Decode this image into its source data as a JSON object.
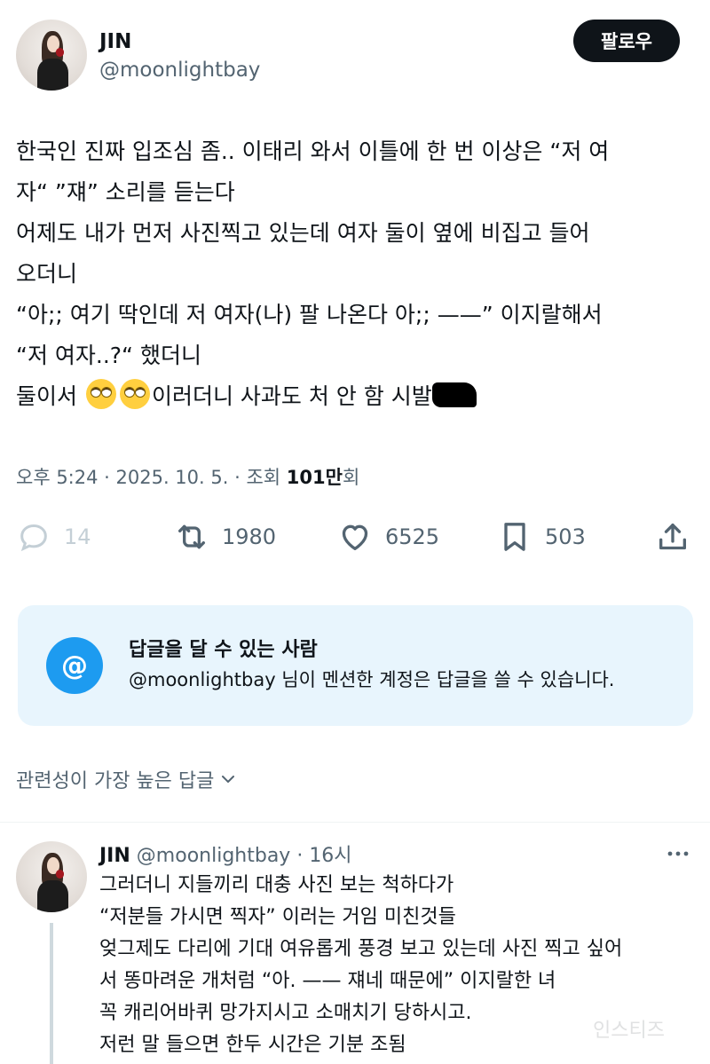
{
  "header": {
    "display_name": "JIN",
    "handle": "@moonlightbay",
    "follow_label": "팔로우"
  },
  "tweet": {
    "lines": [
      "한국인 진짜 입조심 좀.. 이태리 와서 이틀에 한 번 이상은 “저 여",
      "자“ ”쟤” 소리를 듣는다",
      "어제도 내가 먼저 사진찍고 있는데 여자 둘이 옆에 비집고 들어",
      "오더니",
      "“아;; 여기 딱인데 저 여자(나) 팔 나온다 아;; ——” 이지랄해서",
      "“저 여자..?“ 했더니"
    ],
    "last_line_prefix": "둘이서 ",
    "last_line_suffix": "이러더니 사과도 처 안 함 시발",
    "emoji": [
      "face-with-rolling-eyes",
      "face-with-rolling-eyes"
    ]
  },
  "meta": {
    "time": "오후 5:24",
    "sep1": " · ",
    "date": "2025. 10. 5.",
    "sep2": " · ",
    "views_label": "조회 ",
    "views_value": "101만",
    "views_suffix": "회"
  },
  "actions": {
    "reply_count": "14",
    "retweet_count": "1980",
    "like_count": "6525",
    "bookmark_count": "503",
    "icons": [
      "reply-icon",
      "retweet-icon",
      "like-icon",
      "bookmark-icon",
      "share-icon"
    ]
  },
  "reply_restriction": {
    "icon": "@",
    "title": "답글을 달 수 있는 사람",
    "description": "@moonlightbay 님이 멘션한 계정은 답글을 쓸 수 있습니다.",
    "bg_color": "#e8f5fd",
    "icon_color": "#1d9bf0"
  },
  "sort": {
    "label": "관련성이 가장 높은 답글"
  },
  "reply": {
    "name": "JIN",
    "handle": "@moonlightbay",
    "dot": " · ",
    "time": "16시",
    "lines": [
      "그러더니 지들끼리 대충 사진 보는 척하다가",
      "“저분들 가시면 찍자” 이러는 거임 미친것들",
      "엊그제도 다리에 기대 여유롭게 풍경 보고 있는데 사진 찍고 싶어",
      "서 똥마려운 개처럼 “아. —— 쟤네 때문에” 이지랄한 녀",
      "꼭 캐리어바퀴 망가지시고 소매치기 당하시고.",
      "저런 말 들으면 한두 시간은 기분 조됨"
    ]
  },
  "watermark": "인스티즈"
}
